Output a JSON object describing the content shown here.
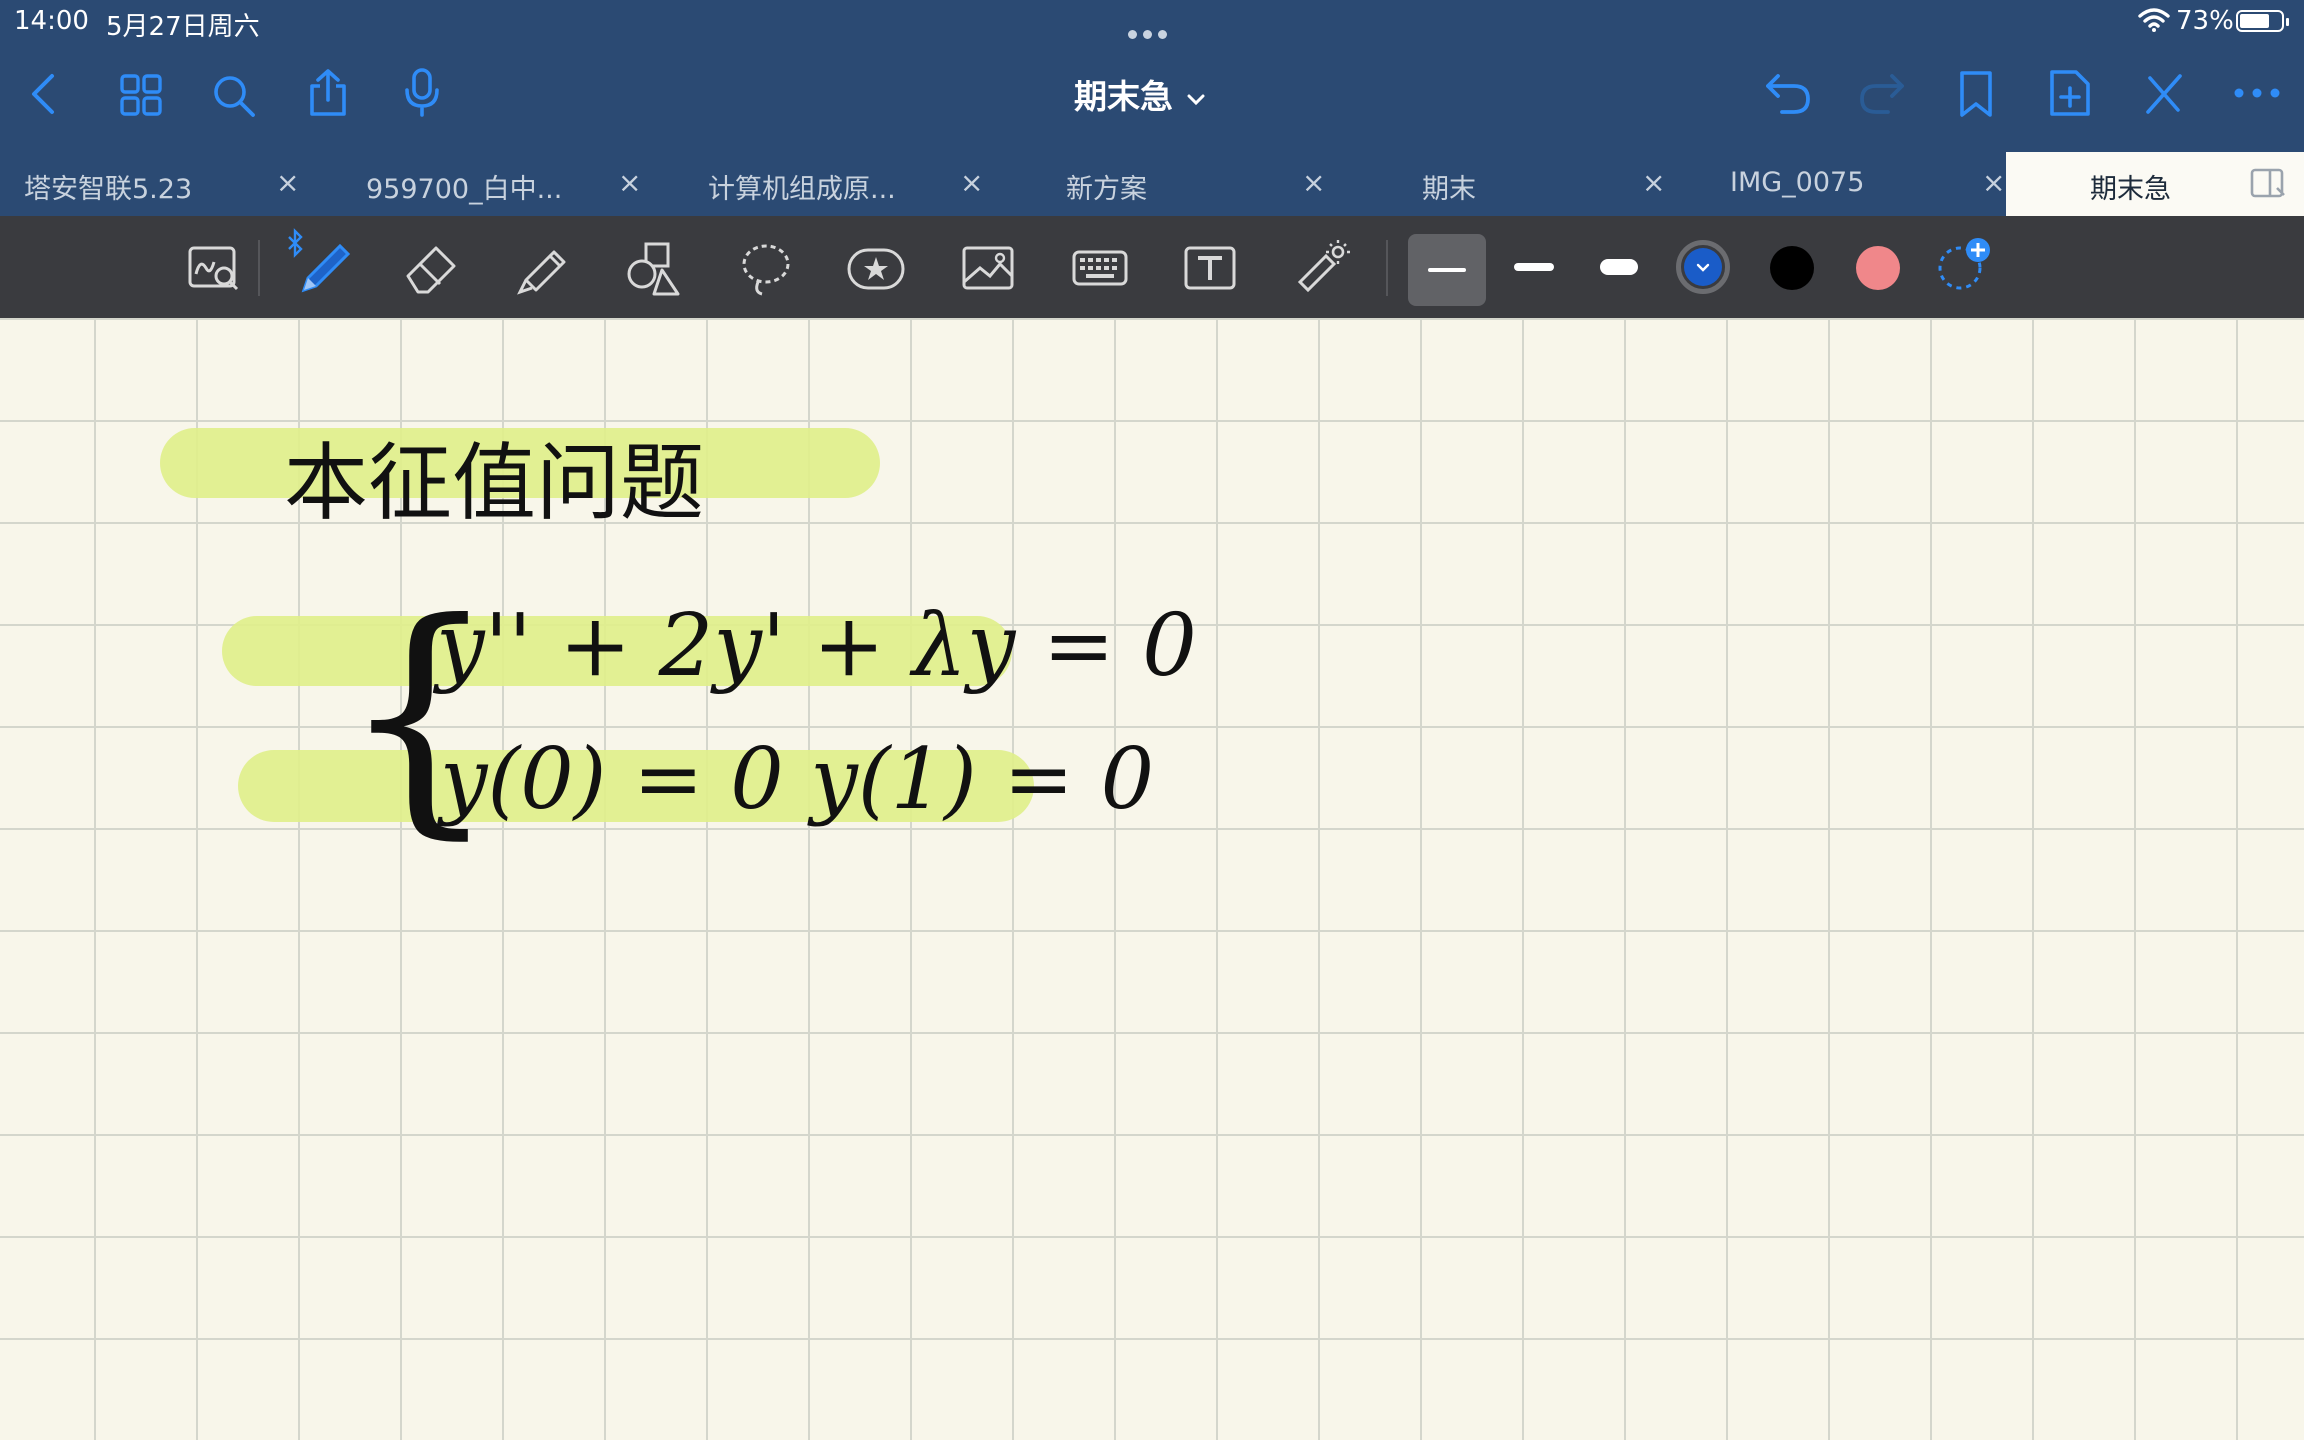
{
  "status_bar": {
    "time": "14:00",
    "date": "5月27日周六",
    "battery": "73%",
    "battery_level": 0.73
  },
  "header": {
    "title": "期末急"
  },
  "tabs": [
    {
      "label": "塔安智联5.23",
      "close": "×"
    },
    {
      "label": "959700_白中...",
      "close": "×"
    },
    {
      "label": "计算机组成原...",
      "close": "×"
    },
    {
      "label": "新方案",
      "close": "×"
    },
    {
      "label": "期末",
      "close": "×"
    },
    {
      "label": "IMG_0075",
      "close": "×"
    },
    {
      "label": "期末急",
      "close": ""
    }
  ],
  "toolbar": {
    "tools": [
      "zoom-window-icon",
      "pen-icon",
      "eraser-icon",
      "highlighter-icon",
      "shapes-icon",
      "lasso-icon",
      "elements-icon",
      "image-icon",
      "keyboard-icon",
      "text-icon",
      "laser-pointer-icon"
    ],
    "colors": [
      "#1a5cc8",
      "#000000",
      "#f0878a"
    ]
  },
  "note": {
    "heading": "本征值问题",
    "equation_line1": "y'' + 2y' + λy = 0",
    "equation_line2": "y(0) = 0    y(1) = 0",
    "brace": "{",
    "highlight_color": "#dfef8b"
  }
}
